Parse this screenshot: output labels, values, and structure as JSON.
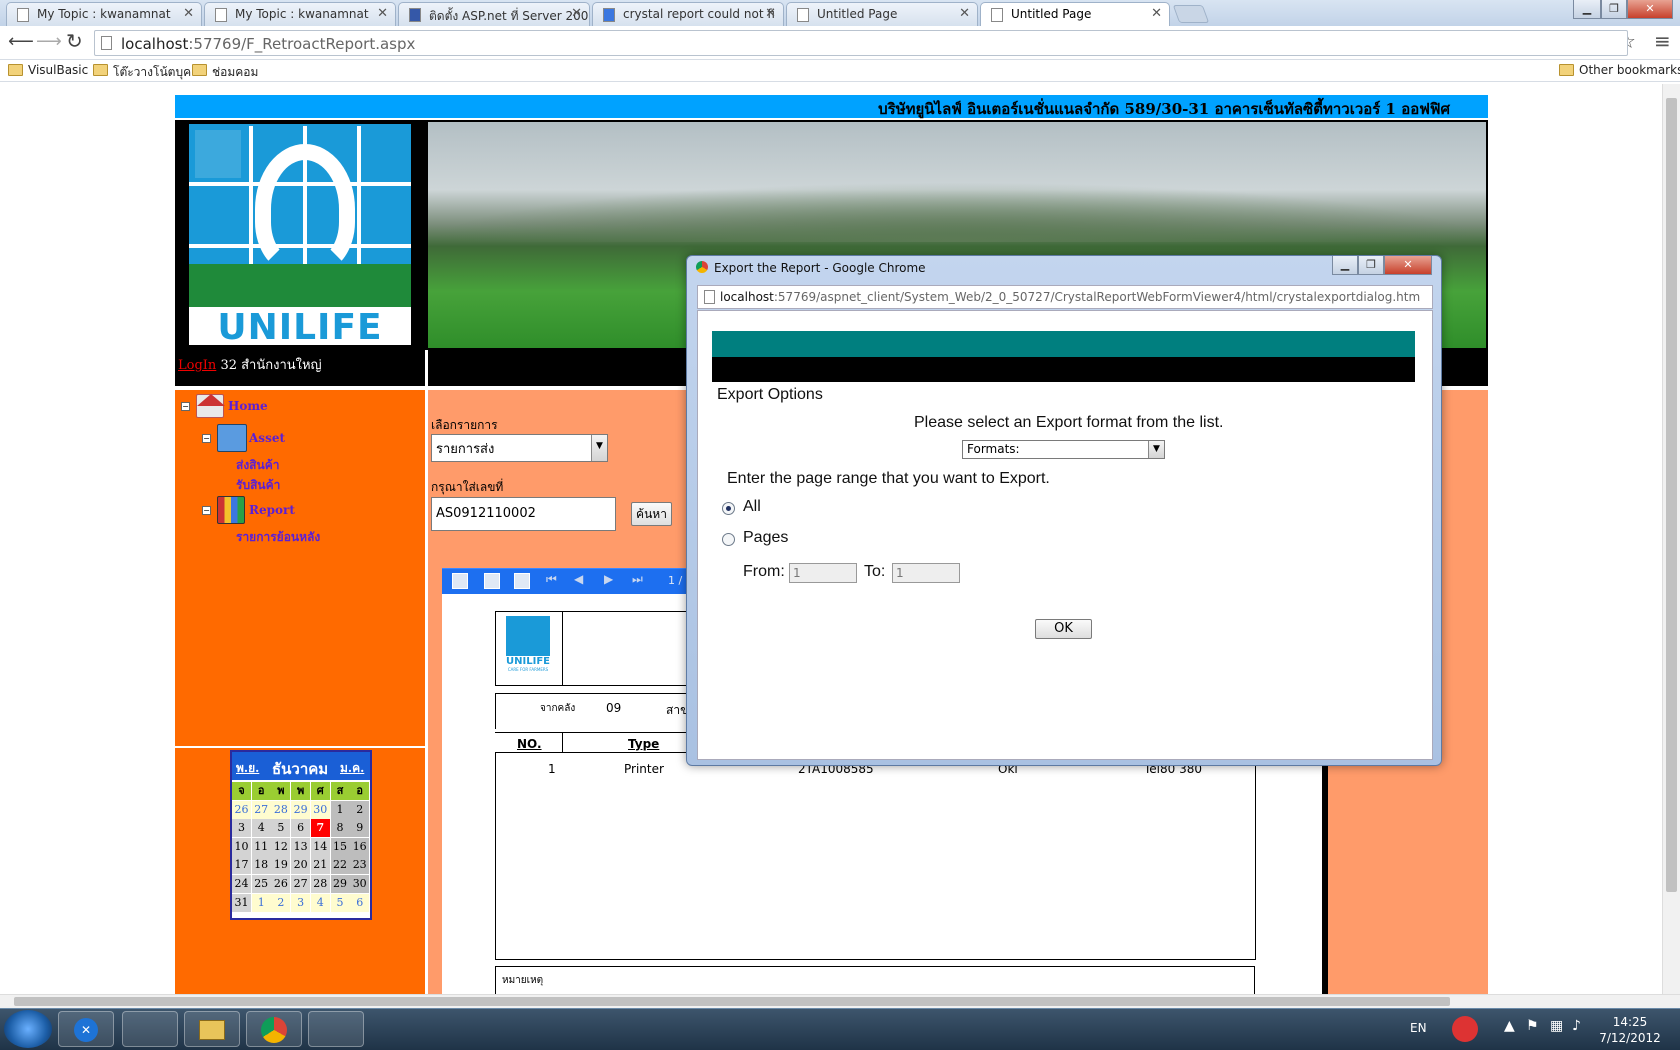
{
  "browser": {
    "tabs": [
      {
        "label": "My Topic : kwanamnat"
      },
      {
        "label": "My Topic : kwanamnat"
      },
      {
        "label": "ติดตั้ง ASP.net ที่ Server 200"
      },
      {
        "label": "crystal report could not fi"
      },
      {
        "label": "Untitled Page"
      },
      {
        "label": "Untitled Page"
      }
    ],
    "url_host": "localhost",
    "url_rest": ":57769/F_RetroactReport.aspx",
    "bookmarks": [
      "VisulBasic",
      "โต๊ะวางโน้ตบุค",
      "ช่อมคอม"
    ],
    "other_bookmarks": "Other bookmarks"
  },
  "page": {
    "banner": "บริษัทยูนิไลฟ์ อินเตอร์เนชั่นแนลจำกัด 589/30-31 อาคารเซ็นทัลซิตี้ทาวเวอร์ 1 ออฟฟิศ",
    "logo_text": "UNILIFE",
    "login_link": "LogIn",
    "login_info": "32 สำนักงานใหญ่",
    "tree": {
      "home": "Home",
      "asset": "Asset",
      "asset_items": [
        "ส่งสินค้า",
        "รับสินค้า"
      ],
      "report": "Report",
      "report_items": [
        "รายการย้อนหลัง"
      ]
    },
    "select_label": "เลือกรายการ",
    "select_value": "รายการส่ง",
    "search_label": "กรุณาใส่เลขที่",
    "search_value": "AS0912110002",
    "search_button": "ค้นหา"
  },
  "report": {
    "page_indicator": "1 /",
    "logo_text": "UNILIFE",
    "logo_sub": "CARE FOR FARMERS",
    "from_label": "จากคลัง",
    "from_value": "09",
    "branch_label": "สาข",
    "col_no": "NO.",
    "col_type": "Type",
    "row": {
      "no": "1",
      "type": "Printer",
      "serial": "2TA1008585",
      "brand": "Oki",
      "model": "Tel80 380"
    },
    "remark": "หมายเหตุ"
  },
  "calendar": {
    "prev": "พ.ย.",
    "month": "ธันวาคม",
    "next": "ม.ค.",
    "weekdays": [
      "จ",
      "อ",
      "พ",
      "พ",
      "ศ",
      "ส",
      "อ"
    ],
    "days": [
      [
        "26",
        "27",
        "28",
        "29",
        "30",
        "1",
        "2"
      ],
      [
        "3",
        "4",
        "5",
        "6",
        "7",
        "8",
        "9"
      ],
      [
        "10",
        "11",
        "12",
        "13",
        "14",
        "15",
        "16"
      ],
      [
        "17",
        "18",
        "19",
        "20",
        "21",
        "22",
        "23"
      ],
      [
        "24",
        "25",
        "26",
        "27",
        "28",
        "29",
        "30"
      ],
      [
        "31",
        "1",
        "2",
        "3",
        "4",
        "5",
        "6"
      ]
    ],
    "today": "7"
  },
  "dialog": {
    "title": "Export the Report - Google Chrome",
    "url_host": "localhost",
    "url_rest": ":57769/aspnet_client/System_Web/2_0_50727/CrystalReportWebFormViewer4/html/crystalexportdialog.htm",
    "export_options": "Export Options",
    "select_prompt": "Please select an Export format from the list.",
    "formats": "Formats:",
    "range_prompt": "Enter the page range that you want to Export.",
    "all": "All",
    "pages": "Pages",
    "from": "From:",
    "from_value": "1",
    "to": "To:",
    "to_value": "1",
    "ok": "OK"
  },
  "taskbar": {
    "lang": "EN",
    "time": "14:25",
    "date": "7/12/2012"
  },
  "colors": {
    "banner": "#00a2ff",
    "orange": "#ff6a00",
    "salmon": "#ff9b6a",
    "teal": "#007f7f"
  }
}
